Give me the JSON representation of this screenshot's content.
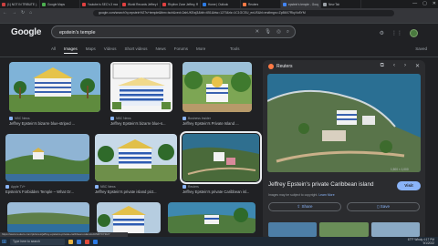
{
  "tabs": [
    {
      "label": "(1) NOT IN TRIBUTE | Jeffrey",
      "color": "#cc4040"
    },
    {
      "label": "Google Maps",
      "color": "#4caf50"
    },
    {
      "label": "Youtube is SEC's 3 months | |",
      "color": "#e04040"
    },
    {
      "label": "World Records Jeffrey Epstein",
      "color": "#e04040"
    },
    {
      "label": "Rhythm Zone Jeffrey, Reuters",
      "color": "#e04040"
    },
    {
      "label": "Home | Outlook",
      "color": "#2c7be5"
    },
    {
      "label": "Reuters",
      "color": "#ff7a45"
    },
    {
      "label": "epstein's temple - Google S",
      "color": "#4285f4",
      "active": true
    },
    {
      "label": "New Tab",
      "color": "#9aa0a6"
    }
  ],
  "window_controls": {
    "minimize": "—",
    "maximize": "▢",
    "close": "✕"
  },
  "address": {
    "url": "google.com/search?q=epstein%27s+temple&tbm=isch&ved=2ahUKEwj3&bih=651&biw=1270&rlz=1C1GCEU_enUS&hl=en#imgrc=ZpB6X7RkyVz8YM"
  },
  "google": {
    "logo": "Google",
    "query": "epstein's temple",
    "filters": [
      "All",
      "Images",
      "Maps",
      "Videos",
      "Short videos",
      "News",
      "Forums",
      "More"
    ],
    "active_filter": "Images",
    "tools_label": "Tools",
    "saved_label": "Saved"
  },
  "results": [
    {
      "source": "NBC News",
      "title": "Jeffrey Epstein's bizarre blue-striped ..."
    },
    {
      "source": "NBC News",
      "title": "Jeffrey Epstein's bizarre blue-s..."
    },
    {
      "source": "Business Insider",
      "title": "Jeffrey Epstein's Private Island ..."
    },
    {
      "source": "Apple TV+",
      "title": "Epstein's Forbidden Temple – What Or..."
    },
    {
      "source": "NBC News",
      "title": "Jeffrey Epstein's private island pict..."
    },
    {
      "source": "Reuters",
      "title": "Jeffrey Epstein's private Caribbean isl..."
    }
  ],
  "panel": {
    "source": "Reuters",
    "title": "Jeffrey Epstein's private Caribbean island",
    "visit_label": "Visit",
    "size_label": "1,500 × 1,000",
    "note_prefix": "Images may be subject to copyright.",
    "note_link": "Learn More",
    "share_label": "Share",
    "save_label": "Save"
  },
  "status_url": "https://www.reuters.com/pictures/jeffrey-epsteins-private-caribbean-island-idUSRTX73I2Y",
  "taskbar": {
    "search_label": "Type here to search",
    "time": "4:17 PM",
    "date": "9/1/2022",
    "weather": "67°F Windy"
  }
}
